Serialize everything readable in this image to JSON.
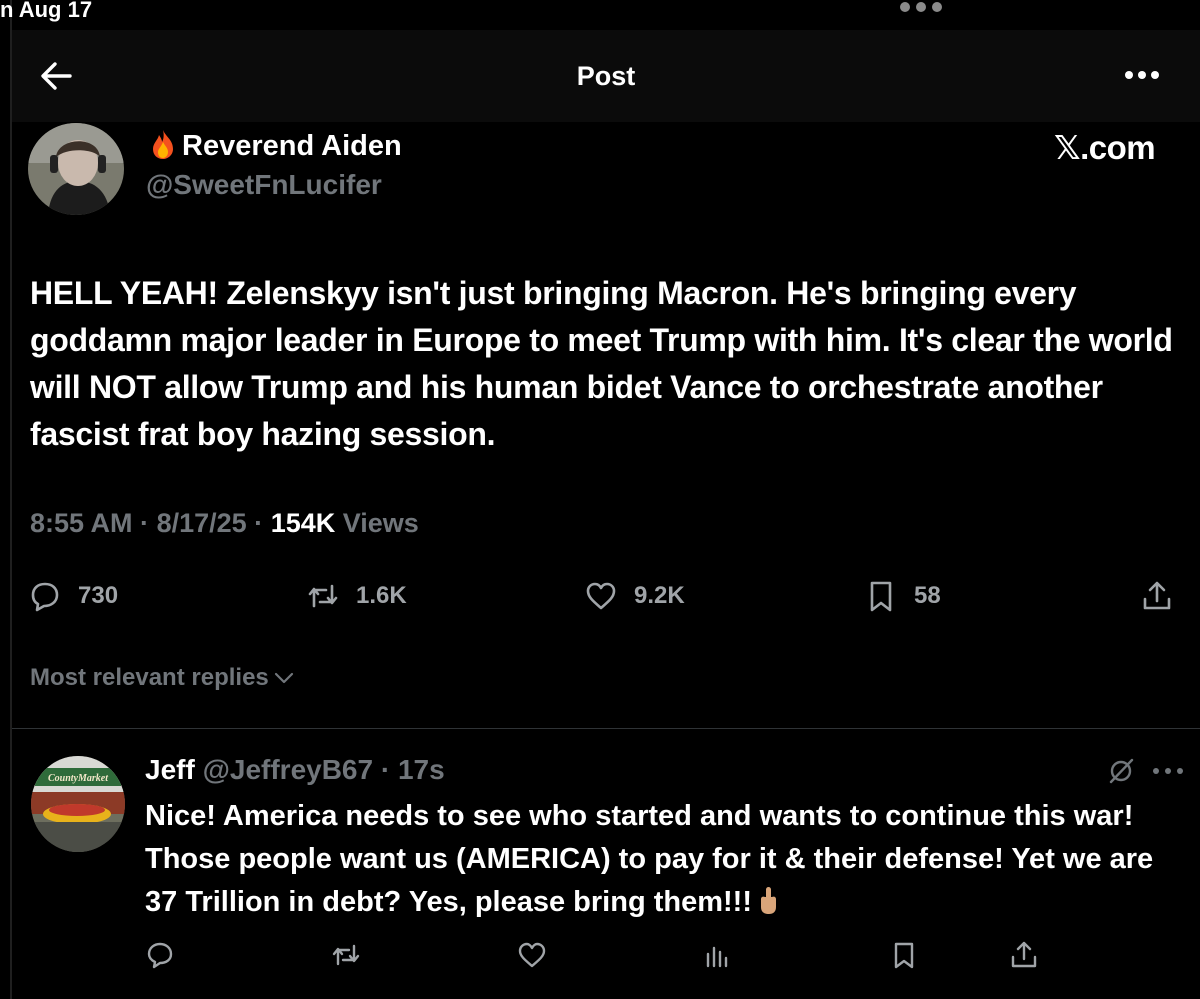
{
  "statusbar": {
    "date": "n Aug 17"
  },
  "header": {
    "title": "Post"
  },
  "post": {
    "author_name": "Reverend Aiden",
    "author_handle": "@SweetFnLucifer",
    "watermark": "𝕏.com",
    "text": "HELL YEAH! Zelenskyy isn't just bringing Macron. He's bringing every goddamn major leader in Europe to meet Trump with him. It's clear the world will NOT allow Trump and his human bidet Vance to orchestrate another fascist frat boy hazing session.",
    "time": "8:55 AM",
    "date": "8/17/25",
    "views_count": "154K",
    "views_label": "Views",
    "stats": {
      "replies": "730",
      "reposts": "1.6K",
      "likes": "9.2K",
      "bookmarks": "58"
    }
  },
  "replies_sort": {
    "label": "Most relevant replies"
  },
  "reply": {
    "name": "Jeff",
    "handle": "@JeffreyB67",
    "time": "17s",
    "avatar_sign_text": "CountyMarket",
    "text": "Nice!  America needs to see who started and wants to continue this war!  Those people want us (AMERICA) to pay for it & their defense! Yet we are 37 Trillion in debt?  Yes, please bring them!!!"
  },
  "icons": {
    "back": "arrow-left-icon",
    "more": "more-horizontal-icon",
    "reply": "comment-icon",
    "repost": "repost-icon",
    "like": "heart-icon",
    "bookmark": "bookmark-icon",
    "share": "share-icon",
    "views": "bar-chart-icon",
    "grok": "grok-icon",
    "chevron": "chevron-down-icon"
  },
  "colors": {
    "background": "#000000",
    "text": "#e7e9ea",
    "muted": "#71767b",
    "divider": "#2f3336"
  }
}
